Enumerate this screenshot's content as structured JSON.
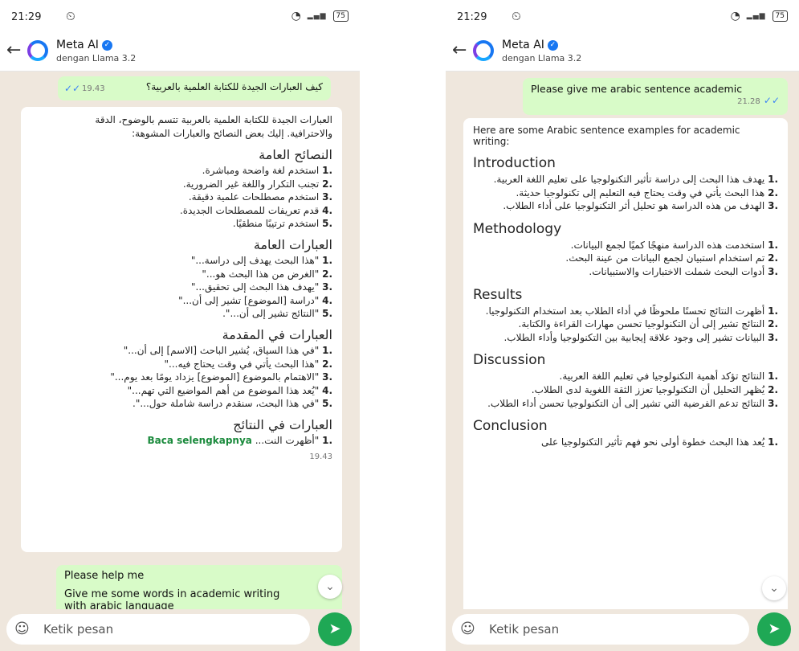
{
  "status": {
    "time": "21:29",
    "battery": "75"
  },
  "header": {
    "name": "Meta AI",
    "subtitle": "dengan Llama 3.2"
  },
  "left": {
    "user_question": "كيف العبارات الجيدة للكتابة العلمية بالعربية؟",
    "user_question_time": "19.43",
    "intro_line1": "العبارات الجيدة للكتابة العلمية بالعربية تتسم بالوضوح، الدقة",
    "intro_line2": "والاحترافية. إليك بعض النصائح والعبارات المشوهة:",
    "sections": [
      {
        "heading": "النصائح العامة",
        "items": [
          "استخدم لغة واضحة ومباشرة.",
          "تجنب التكرار واللغة غير الضرورية.",
          "استخدم مصطلحات علمية دقيقة.",
          "قدم تعريفات للمصطلحات الجديدة.",
          "استخدم ترتيبًا منطقيًا."
        ]
      },
      {
        "heading": "العبارات العامة",
        "items": [
          "\"هذا البحث يهدف إلى دراسة...\"",
          "\"الغرض من هذا البحث هو...\"",
          "\"يهدف هذا البحث إلى تحقيق...\"",
          "\"دراسة [الموضوع] تشير إلى أن...\"",
          "\"النتائج تشير إلى أن...\"."
        ]
      },
      {
        "heading": "العبارات في المقدمة",
        "items": [
          "\"في هذا السياق، يُشير الباحث [الاسم] إلى أن...\"",
          "\"هذا البحث يأتي في وقت يحتاج فيه...\"",
          "\"الاهتمام بالموضوع [الموضوع] يزداد يومًا بعد يوم...\"",
          "\"يُعد هذا الموضوع من أهم المواضيع التي تهم...\"",
          "\"في هذا البحث، سنقدم دراسة شاملة حول...\"."
        ]
      },
      {
        "heading": "العبارات في النتائج",
        "items": []
      }
    ],
    "last_item": "\"أظهرت النت...",
    "read_more": "Baca selengkapnya",
    "reply_time": "19.43",
    "next_line1": "Please help me",
    "next_line2": "Give me some words in academic writing",
    "next_line3": "with arabic language"
  },
  "right": {
    "user_message": "Please give me arabic sentence academic",
    "user_time": "21.28",
    "intro": "Here are some Arabic sentence examples for academic writing:",
    "sections": [
      {
        "heading": "Introduction",
        "items": [
          "يهدف هذا البحث إلى دراسة تأثير التكنولوجيا على تعليم اللغة العربية.",
          "هذا البحث يأتي في وقت يحتاج فيه التعليم إلى تكنولوجيا حديثة.",
          "الهدف من هذه الدراسة هو تحليل أثر التكنولوجيا على أداء الطلاب."
        ]
      },
      {
        "heading": "Methodology",
        "items": [
          "استخدمت هذه الدراسة منهجًا كميًا لجمع البيانات.",
          "تم استخدام استبيان لجمع البيانات من عينة البحث.",
          "أدوات البحث شملت الاختبارات والاستبيانات."
        ]
      },
      {
        "heading": "Results",
        "items": [
          "أظهرت النتائج تحسنًا ملحوظًا في أداء الطلاب بعد استخدام التكنولوجيا.",
          "النتائج تشير إلى أن التكنولوجيا تحسن مهارات القراءة والكتابة.",
          "البيانات تشير إلى وجود علاقة إيجابية بين التكنولوجيا وأداء الطلاب."
        ]
      },
      {
        "heading": "Discussion",
        "items": [
          "النتائج تؤكد أهمية التكنولوجيا في تعليم اللغة العربية.",
          "يُظهر التحليل أن التكنولوجيا تعزز الثقة اللغوية لدى الطلاب.",
          "النتائج تدعم الفرضية التي تشير إلى أن التكنولوجيا تحسن أداء الطلاب."
        ]
      },
      {
        "heading": "Conclusion",
        "items": [
          "يُعد هذا البحث خطوة أولى نحو فهم تأثير التكنولوجيا على"
        ]
      }
    ]
  },
  "input": {
    "placeholder": "Ketik pesan"
  },
  "colors": {
    "out_bubble": "#d8fbc8",
    "send": "#1fa855",
    "read_ticks": "#3b82f6",
    "read_more": "#1a8a3c"
  }
}
